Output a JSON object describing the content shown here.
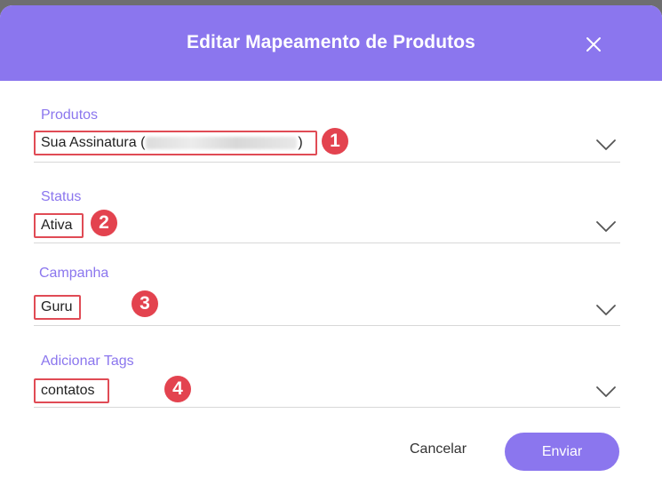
{
  "dialog": {
    "title": "Editar Mapeamento de Produtos",
    "close_icon": "close-icon"
  },
  "fields": [
    {
      "label": "Produtos",
      "value_prefix": "Sua Assinatura (",
      "value_suffix": ")",
      "value_redacted": true,
      "marker": "1"
    },
    {
      "label": "Status",
      "value": "Ativa",
      "marker": "2"
    },
    {
      "label": "Campanha",
      "value": "Guru",
      "marker": "3"
    },
    {
      "label": "Adicionar Tags",
      "value": "contatos",
      "marker": "4"
    }
  ],
  "actions": {
    "cancel_label": "Cancelar",
    "submit_label": "Enviar"
  },
  "colors": {
    "accent": "#8b76ee",
    "highlight": "#e04b55",
    "badge": "#e3434f"
  }
}
